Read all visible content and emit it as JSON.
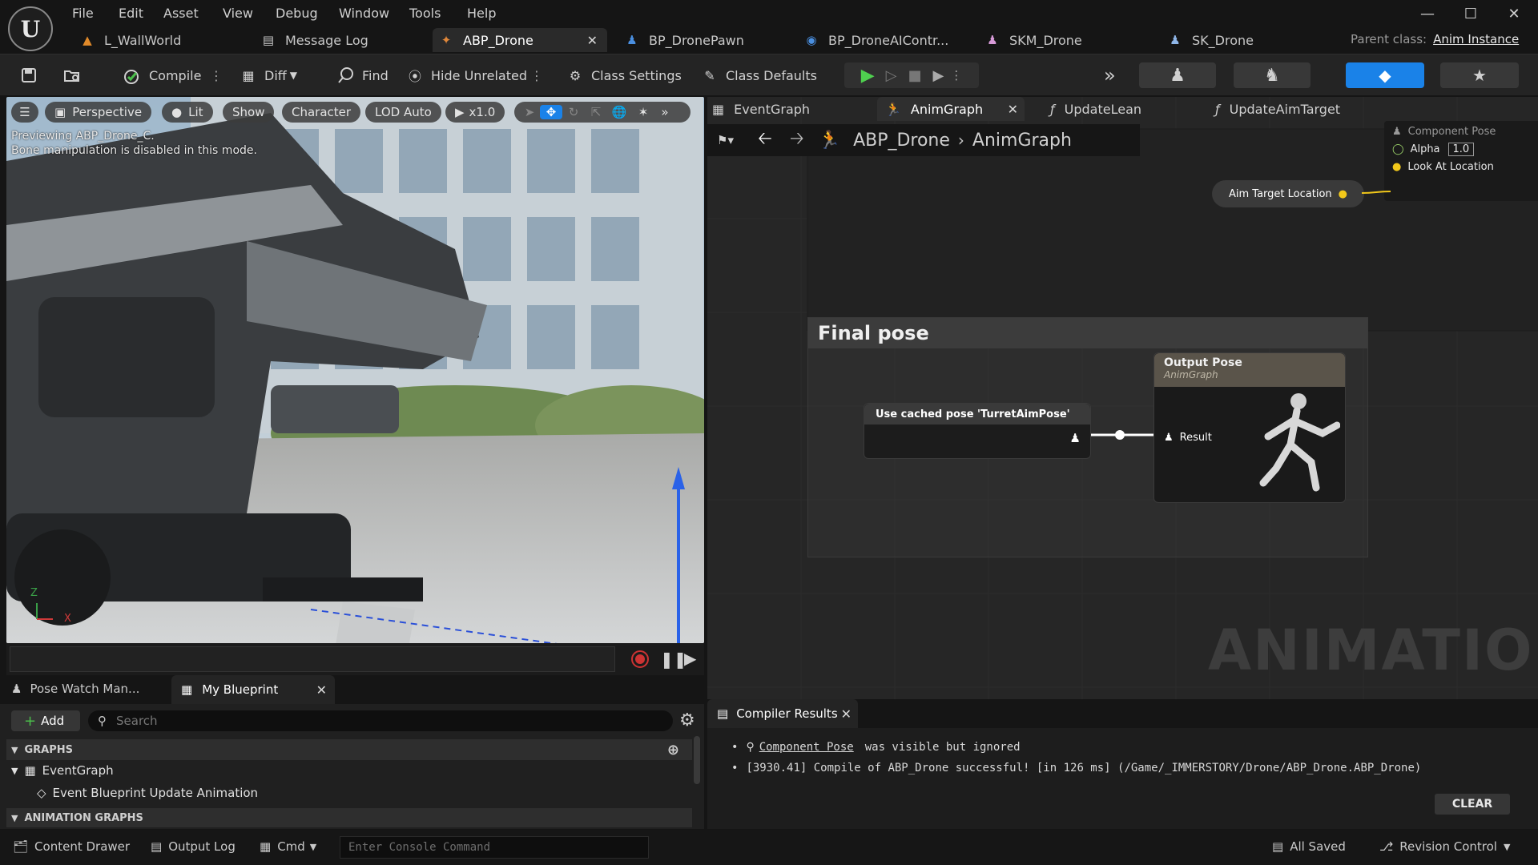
{
  "menu": [
    "File",
    "Edit",
    "Asset",
    "View",
    "Debug",
    "Window",
    "Tools",
    "Help"
  ],
  "doc_tabs": [
    {
      "label": "L_WallWorld",
      "icon": "level-icon"
    },
    {
      "label": "Message Log",
      "icon": "message-log-icon"
    },
    {
      "label": "ABP_Drone",
      "icon": "anim-blueprint-icon",
      "active": true
    },
    {
      "label": "BP_DronePawn",
      "icon": "pawn-icon"
    },
    {
      "label": "BP_DroneAIContr...",
      "icon": "controller-icon"
    },
    {
      "label": "SKM_Drone",
      "icon": "skeletal-mesh-icon"
    },
    {
      "label": "SK_Drone",
      "icon": "skeleton-icon"
    }
  ],
  "parent_class": {
    "label": "Parent class:",
    "value": "Anim Instance"
  },
  "toolbar": {
    "compile": "Compile",
    "diff": "Diff",
    "find": "Find",
    "hide_unrelated": "Hide Unrelated",
    "class_settings": "Class Settings",
    "class_defaults": "Class Defaults"
  },
  "viewport": {
    "perspective": "Perspective",
    "lit": "Lit",
    "show": "Show",
    "character": "Character",
    "lod": "LOD Auto",
    "speed": "x1.0",
    "message_line1": "Previewing ABP_Drone_C.",
    "message_line2": "Bone manipulation is disabled in this mode.",
    "axis_z": "Z",
    "axis_x": "X"
  },
  "graph_tabs": [
    {
      "label": "EventGraph"
    },
    {
      "label": "AnimGraph",
      "active": true
    },
    {
      "label": "UpdateLean"
    },
    {
      "label": "UpdateAimTarget"
    }
  ],
  "breadcrumb": {
    "root": "ABP_Drone",
    "current": "AnimGraph"
  },
  "graph": {
    "top_node": {
      "component_pose": "Component Pose",
      "alpha_label": "Alpha",
      "alpha_value": "1.0",
      "look_at": "Look At Location"
    },
    "aim_target_node": "Aim Target Location",
    "comment_title": "Final pose",
    "cached_node": "Use cached pose 'TurretAimPose'",
    "output_node_title": "Output Pose",
    "output_node_subtitle": "AnimGraph",
    "result_pin": "Result",
    "watermark": "ANIMATION"
  },
  "left_panel": {
    "tab1": "Pose Watch Man...",
    "tab2": "My Blueprint",
    "add_button": "Add",
    "search_placeholder": "Search",
    "graphs_header": "GRAPHS",
    "event_graph": "EventGraph",
    "event_update": "Event Blueprint Update Animation",
    "anim_graphs_header": "ANIMATION GRAPHS"
  },
  "compiler": {
    "tab": "Compiler Results",
    "line1_link": "Component Pose",
    "line1_text": "was visible but ignored",
    "line2": "[3930.41] Compile of ABP_Drone successful! [in 126 ms] (/Game/_IMMERSTORY/Drone/ABP_Drone.ABP_Drone)",
    "clear": "CLEAR"
  },
  "statusbar": {
    "content_drawer": "Content Drawer",
    "output_log": "Output Log",
    "cmd": "Cmd",
    "console_placeholder": "Enter Console Command",
    "all_saved": "All Saved",
    "revision_control": "Revision Control"
  }
}
